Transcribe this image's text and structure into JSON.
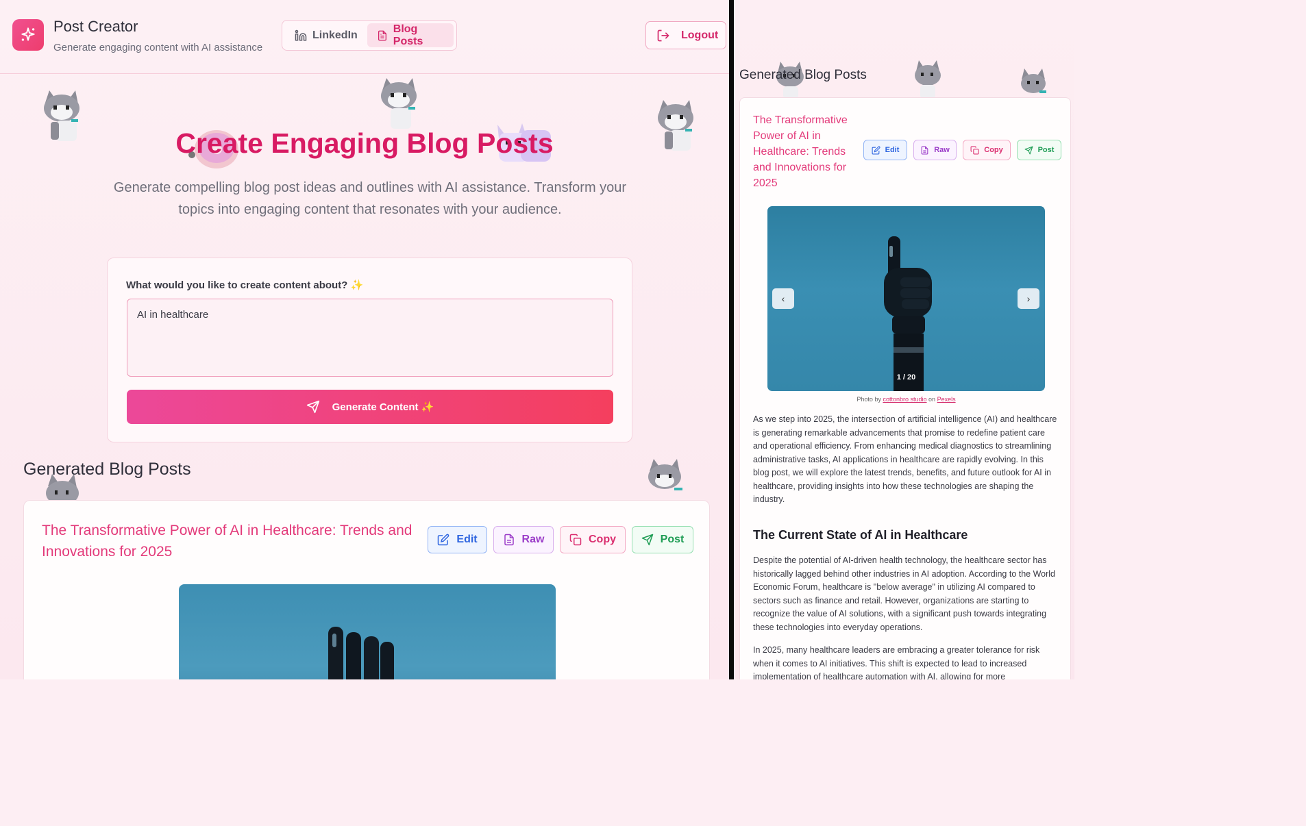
{
  "header": {
    "app_title": "Post Creator",
    "app_subtitle": "Generate engaging content with AI assistance",
    "tabs": [
      {
        "label": "LinkedIn",
        "icon": "linkedin-icon",
        "active": false
      },
      {
        "label": "Blog Posts",
        "icon": "document-icon",
        "active": true
      }
    ],
    "logout_label": "Logout"
  },
  "hero": {
    "title": "Create Engaging Blog Posts",
    "subtitle": "Generate compelling blog post ideas and outlines with AI assistance. Transform your topics into engaging content that resonates with your audience."
  },
  "form": {
    "label": "What would you like to create content about? ✨",
    "input_value": "AI in healthcare",
    "generate_label": "Generate Content ✨"
  },
  "generated": {
    "section_title": "Generated Blog Posts",
    "post": {
      "title": "The Transformative Power of AI in Healthcare: Trends and Innovations for 2025",
      "actions": {
        "edit": "Edit",
        "raw": "Raw",
        "copy": "Copy",
        "post": "Post"
      },
      "image_counter": "1 / 20",
      "credit": {
        "prefix": "Photo by",
        "author": "cottonbro studio",
        "on": "on",
        "source": "Pexels"
      },
      "intro": "As we step into 2025, the intersection of artificial intelligence (AI) and healthcare is generating remarkable advancements that promise to redefine patient care and operational efficiency. From enhancing medical diagnostics to streamlining administrative tasks, AI applications in healthcare are rapidly evolving. In this blog post, we will explore the latest trends, benefits, and future outlook for AI in healthcare, providing insights into how these technologies are shaping the industry.",
      "heading_1": "The Current State of AI in Healthcare",
      "para_1": "Despite the potential of AI-driven health technology, the healthcare sector has historically lagged behind other industries in AI adoption. According to the World Economic Forum, healthcare is \"below average\" in utilizing AI compared to sectors such as finance and retail. However, organizations are starting to recognize the value of AI solutions, with a significant push towards integrating these technologies into everyday operations.",
      "para_2": "In 2025, many healthcare leaders are embracing a greater tolerance for risk when it comes to AI initiatives. This shift is expected to lead to increased implementation of healthcare automation with AI, allowing for more"
    }
  },
  "colors": {
    "brand_pink": "#d81b63",
    "accent_gradient_start": "#ec4899",
    "accent_gradient_end": "#f43f5e",
    "edit_blue": "#2f66e0",
    "raw_purple": "#9b3dc9",
    "copy_pink": "#db2f70",
    "post_green": "#1f9d55"
  }
}
